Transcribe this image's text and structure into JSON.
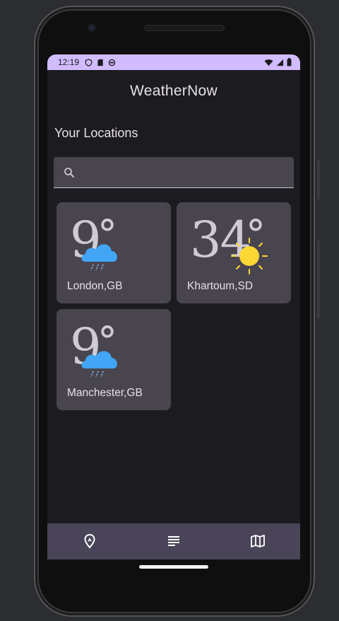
{
  "status": {
    "time": "12:19"
  },
  "app": {
    "title": "WeatherNow",
    "section_title": "Your Locations"
  },
  "search": {
    "value": "",
    "placeholder": ""
  },
  "locations": [
    {
      "temp": "9",
      "unit": "°",
      "city": "London,GB",
      "condition": "rain-cloud-icon"
    },
    {
      "temp": "34",
      "unit": "°",
      "city": "Khartoum,SD",
      "condition": "sun-icon"
    },
    {
      "temp": "9",
      "unit": "°",
      "city": "Manchester,GB",
      "condition": "rain-cloud-icon"
    }
  ],
  "bottom_nav": {
    "items": [
      "location-pin-icon",
      "list-icon",
      "map-icon"
    ]
  },
  "colors": {
    "accent": "#d0bcff",
    "background": "#1c1b1f",
    "card": "#49454f",
    "nav": "#4a4458",
    "cloud": "#42a5f5",
    "sun": "#fdd835"
  }
}
